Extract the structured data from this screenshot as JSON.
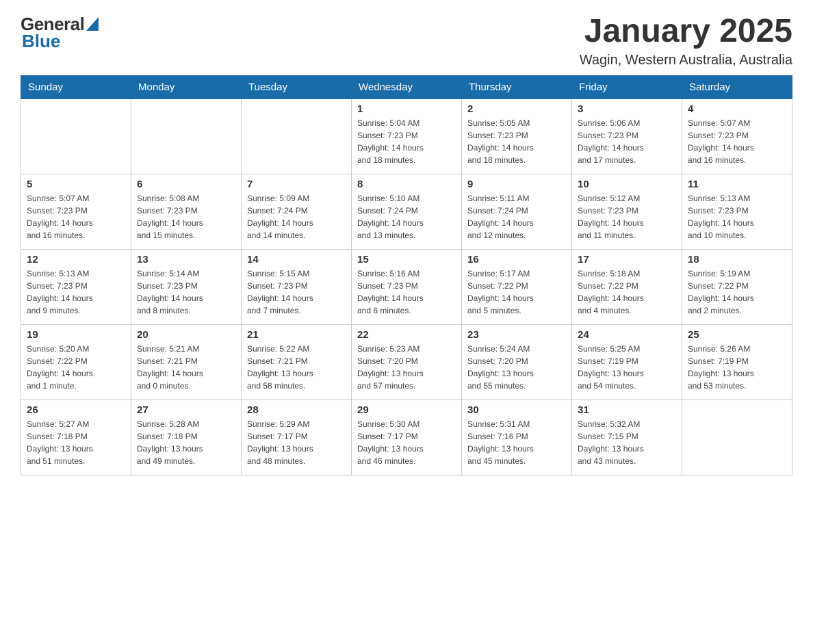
{
  "logo": {
    "general": "General",
    "blue": "Blue"
  },
  "title": "January 2025",
  "subtitle": "Wagin, Western Australia, Australia",
  "days_of_week": [
    "Sunday",
    "Monday",
    "Tuesday",
    "Wednesday",
    "Thursday",
    "Friday",
    "Saturday"
  ],
  "weeks": [
    [
      {
        "day": "",
        "info": ""
      },
      {
        "day": "",
        "info": ""
      },
      {
        "day": "",
        "info": ""
      },
      {
        "day": "1",
        "info": "Sunrise: 5:04 AM\nSunset: 7:23 PM\nDaylight: 14 hours\nand 18 minutes."
      },
      {
        "day": "2",
        "info": "Sunrise: 5:05 AM\nSunset: 7:23 PM\nDaylight: 14 hours\nand 18 minutes."
      },
      {
        "day": "3",
        "info": "Sunrise: 5:06 AM\nSunset: 7:23 PM\nDaylight: 14 hours\nand 17 minutes."
      },
      {
        "day": "4",
        "info": "Sunrise: 5:07 AM\nSunset: 7:23 PM\nDaylight: 14 hours\nand 16 minutes."
      }
    ],
    [
      {
        "day": "5",
        "info": "Sunrise: 5:07 AM\nSunset: 7:23 PM\nDaylight: 14 hours\nand 16 minutes."
      },
      {
        "day": "6",
        "info": "Sunrise: 5:08 AM\nSunset: 7:23 PM\nDaylight: 14 hours\nand 15 minutes."
      },
      {
        "day": "7",
        "info": "Sunrise: 5:09 AM\nSunset: 7:24 PM\nDaylight: 14 hours\nand 14 minutes."
      },
      {
        "day": "8",
        "info": "Sunrise: 5:10 AM\nSunset: 7:24 PM\nDaylight: 14 hours\nand 13 minutes."
      },
      {
        "day": "9",
        "info": "Sunrise: 5:11 AM\nSunset: 7:24 PM\nDaylight: 14 hours\nand 12 minutes."
      },
      {
        "day": "10",
        "info": "Sunrise: 5:12 AM\nSunset: 7:23 PM\nDaylight: 14 hours\nand 11 minutes."
      },
      {
        "day": "11",
        "info": "Sunrise: 5:13 AM\nSunset: 7:23 PM\nDaylight: 14 hours\nand 10 minutes."
      }
    ],
    [
      {
        "day": "12",
        "info": "Sunrise: 5:13 AM\nSunset: 7:23 PM\nDaylight: 14 hours\nand 9 minutes."
      },
      {
        "day": "13",
        "info": "Sunrise: 5:14 AM\nSunset: 7:23 PM\nDaylight: 14 hours\nand 8 minutes."
      },
      {
        "day": "14",
        "info": "Sunrise: 5:15 AM\nSunset: 7:23 PM\nDaylight: 14 hours\nand 7 minutes."
      },
      {
        "day": "15",
        "info": "Sunrise: 5:16 AM\nSunset: 7:23 PM\nDaylight: 14 hours\nand 6 minutes."
      },
      {
        "day": "16",
        "info": "Sunrise: 5:17 AM\nSunset: 7:22 PM\nDaylight: 14 hours\nand 5 minutes."
      },
      {
        "day": "17",
        "info": "Sunrise: 5:18 AM\nSunset: 7:22 PM\nDaylight: 14 hours\nand 4 minutes."
      },
      {
        "day": "18",
        "info": "Sunrise: 5:19 AM\nSunset: 7:22 PM\nDaylight: 14 hours\nand 2 minutes."
      }
    ],
    [
      {
        "day": "19",
        "info": "Sunrise: 5:20 AM\nSunset: 7:22 PM\nDaylight: 14 hours\nand 1 minute."
      },
      {
        "day": "20",
        "info": "Sunrise: 5:21 AM\nSunset: 7:21 PM\nDaylight: 14 hours\nand 0 minutes."
      },
      {
        "day": "21",
        "info": "Sunrise: 5:22 AM\nSunset: 7:21 PM\nDaylight: 13 hours\nand 58 minutes."
      },
      {
        "day": "22",
        "info": "Sunrise: 5:23 AM\nSunset: 7:20 PM\nDaylight: 13 hours\nand 57 minutes."
      },
      {
        "day": "23",
        "info": "Sunrise: 5:24 AM\nSunset: 7:20 PM\nDaylight: 13 hours\nand 55 minutes."
      },
      {
        "day": "24",
        "info": "Sunrise: 5:25 AM\nSunset: 7:19 PM\nDaylight: 13 hours\nand 54 minutes."
      },
      {
        "day": "25",
        "info": "Sunrise: 5:26 AM\nSunset: 7:19 PM\nDaylight: 13 hours\nand 53 minutes."
      }
    ],
    [
      {
        "day": "26",
        "info": "Sunrise: 5:27 AM\nSunset: 7:18 PM\nDaylight: 13 hours\nand 51 minutes."
      },
      {
        "day": "27",
        "info": "Sunrise: 5:28 AM\nSunset: 7:18 PM\nDaylight: 13 hours\nand 49 minutes."
      },
      {
        "day": "28",
        "info": "Sunrise: 5:29 AM\nSunset: 7:17 PM\nDaylight: 13 hours\nand 48 minutes."
      },
      {
        "day": "29",
        "info": "Sunrise: 5:30 AM\nSunset: 7:17 PM\nDaylight: 13 hours\nand 46 minutes."
      },
      {
        "day": "30",
        "info": "Sunrise: 5:31 AM\nSunset: 7:16 PM\nDaylight: 13 hours\nand 45 minutes."
      },
      {
        "day": "31",
        "info": "Sunrise: 5:32 AM\nSunset: 7:15 PM\nDaylight: 13 hours\nand 43 minutes."
      },
      {
        "day": "",
        "info": ""
      }
    ]
  ]
}
